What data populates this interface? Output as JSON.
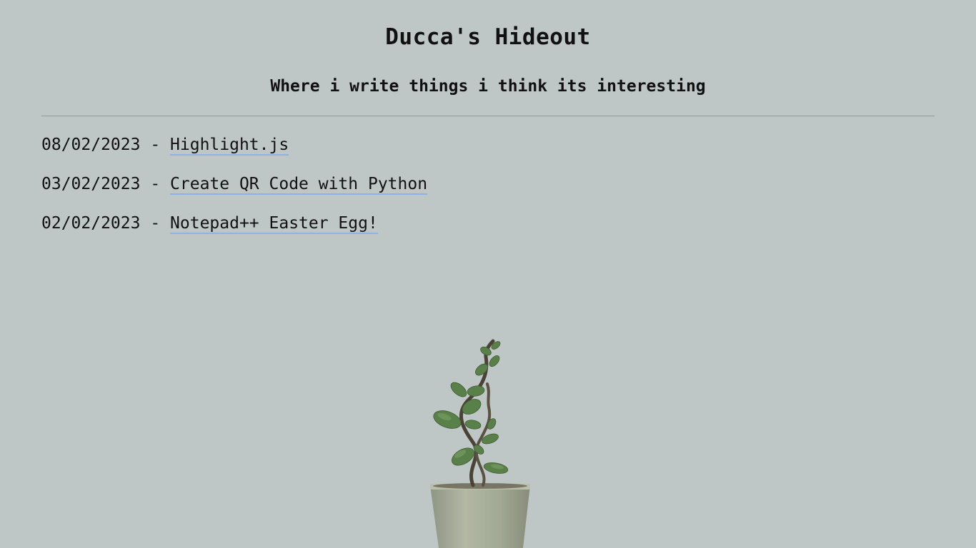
{
  "header": {
    "title": "Ducca's Hideout",
    "subtitle": "Where i write things i think its interesting"
  },
  "posts": [
    {
      "date": "08/02/2023",
      "separator": " - ",
      "title": "Highlight.js"
    },
    {
      "date": "03/02/2023",
      "separator": " - ",
      "title": "Create QR Code with Python"
    },
    {
      "date": "02/02/2023",
      "separator": " - ",
      "title": "Notepad++ Easter Egg!"
    }
  ],
  "colors": {
    "background": "#bec7c5",
    "link_underline": "#8fb2e6",
    "leaf": "#5a8049",
    "pot": "#a7ad98"
  },
  "illustration": {
    "icon": "potted-plant-icon"
  }
}
